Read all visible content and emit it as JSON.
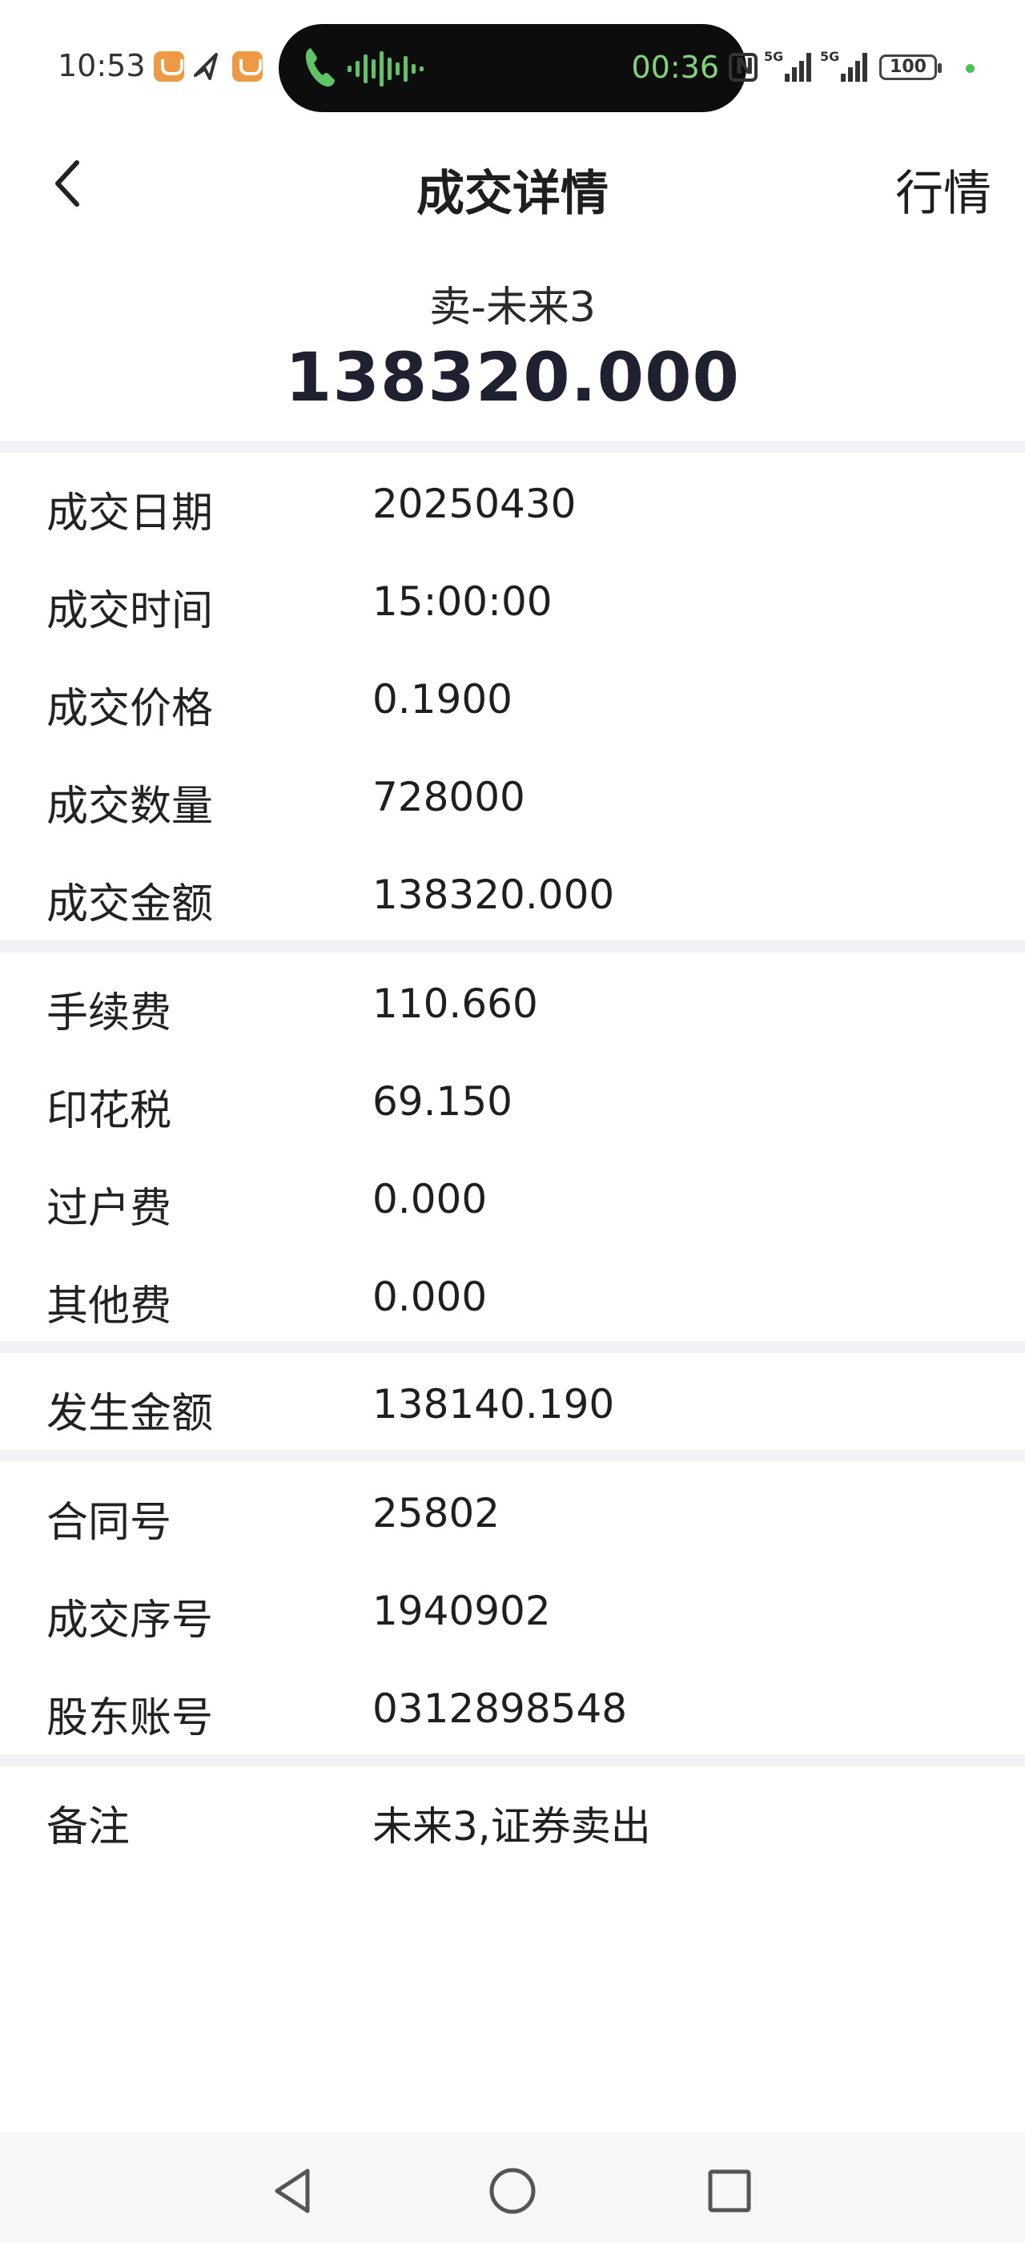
{
  "status_bar": {
    "time": "10:53",
    "call_duration": "00:36",
    "battery": "100",
    "network_1": "5G",
    "network_2": "5G"
  },
  "header": {
    "title": "成交详情",
    "right_action": "行情"
  },
  "summary": {
    "label": "卖-未来3",
    "amount": "138320.000"
  },
  "groups": [
    [
      {
        "label": "成交日期",
        "value": "20250430"
      },
      {
        "label": "成交时间",
        "value": "15:00:00"
      },
      {
        "label": "成交价格",
        "value": "0.1900"
      },
      {
        "label": "成交数量",
        "value": "728000"
      },
      {
        "label": "成交金额",
        "value": "138320.000"
      }
    ],
    [
      {
        "label": "手续费",
        "value": "110.660"
      },
      {
        "label": "印花税",
        "value": "69.150"
      },
      {
        "label": "过户费",
        "value": "0.000"
      },
      {
        "label": "其他费",
        "value": "0.000"
      }
    ],
    [
      {
        "label": "发生金额",
        "value": "138140.190"
      }
    ],
    [
      {
        "label": "合同号",
        "value": "25802"
      },
      {
        "label": "成交序号",
        "value": "1940902"
      },
      {
        "label": "股东账号",
        "value": "0312898548"
      }
    ],
    [
      {
        "label": "备注",
        "value": "未来3,证券卖出"
      }
    ]
  ],
  "colors": {
    "call_pill": "#0d0d0d",
    "call_text": "#7ed67a",
    "app_badge": "#ee9a45",
    "divider": "#f1f2f4"
  }
}
